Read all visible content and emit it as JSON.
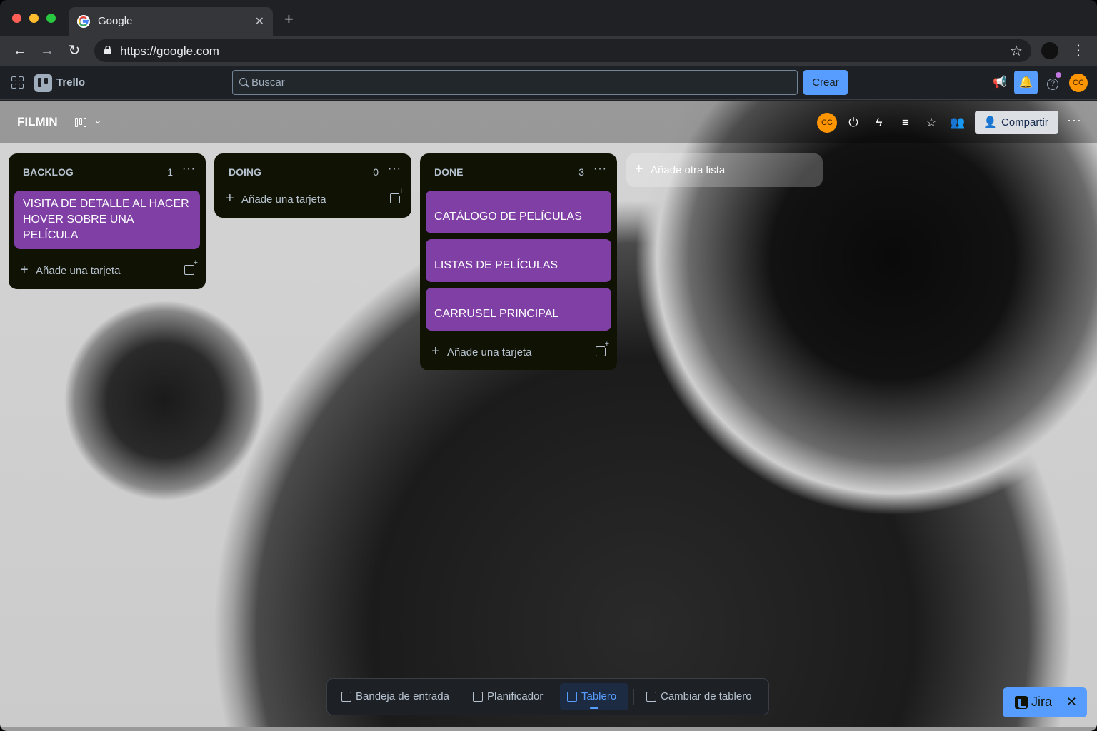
{
  "browser": {
    "tab_title": "Google",
    "url": "https://google.com"
  },
  "trello": {
    "app_name": "Trello",
    "search_placeholder": "Buscar",
    "create_label": "Crear",
    "user_initials": "CC"
  },
  "board": {
    "title": "FILMIN",
    "member_initials": "CC",
    "share_label": "Compartir",
    "lists": [
      {
        "title": "BACKLOG",
        "count": "1",
        "cards": [
          "VISITA DE DETALLE AL HACER HOVER SOBRE UNA PELÍCULA"
        ],
        "add_card_label": "Añade una tarjeta"
      },
      {
        "title": "DOING",
        "count": "0",
        "cards": [],
        "add_card_label": "Añade una tarjeta"
      },
      {
        "title": "DONE",
        "count": "3",
        "cards": [
          "CATÁLOGO DE PELÍCULAS",
          "LISTAS DE PELÍCULAS",
          "CARRUSEL PRINCIPAL"
        ],
        "add_card_label": "Añade una tarjeta"
      }
    ],
    "add_list_label": "Añade otra lista",
    "card_color": "#803fa5"
  },
  "dock": {
    "inbox": "Bandeja de entrada",
    "planner": "Planificador",
    "board": "Tablero",
    "switch_board": "Cambiar de tablero"
  },
  "jira": {
    "label": "Jira"
  },
  "colors": {
    "accent": "#579dff",
    "avatar": "#ff9500"
  }
}
